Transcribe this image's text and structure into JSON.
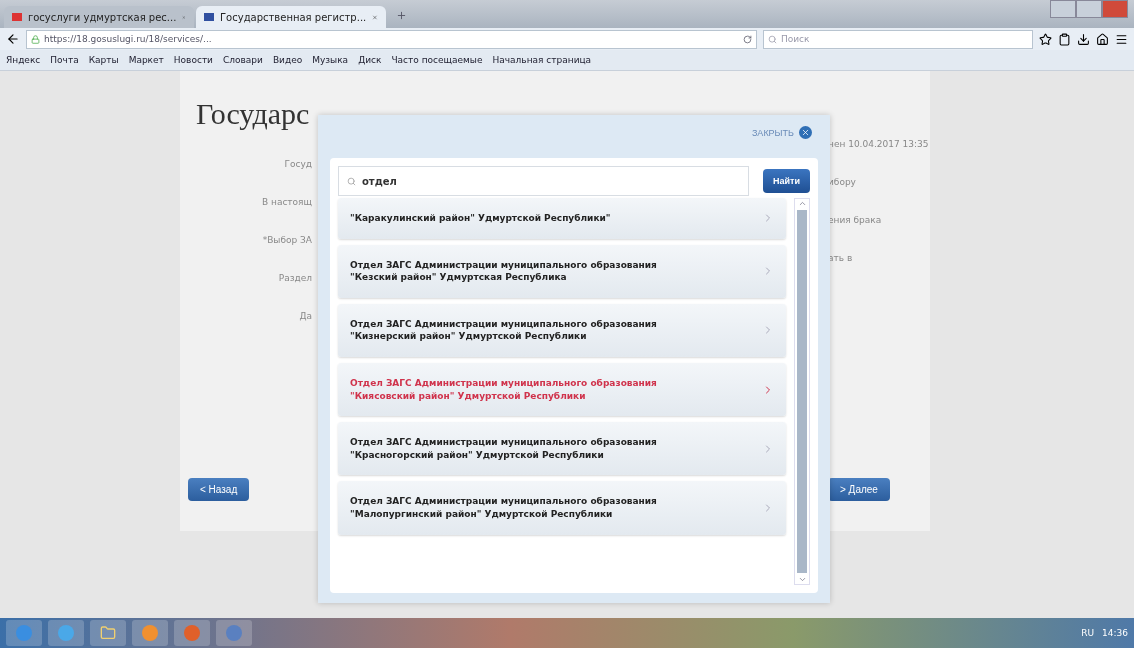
{
  "browser": {
    "tabs": [
      {
        "title": "госуслуги удмуртская рес...",
        "selected": false
      },
      {
        "title": "Государственная регистр...",
        "selected": true
      }
    ],
    "url": "https://18.gosuslugi.ru/18/services/...",
    "search_placeholder": "Поиск",
    "bookmarks": [
      "Яндекс",
      "Почта",
      "Карты",
      "Маркет",
      "Новости",
      "Словари",
      "Видео",
      "Музыка",
      "Диск",
      "Часто посещаемые",
      "Начальная страница"
    ]
  },
  "page": {
    "heading": "Государс",
    "left_labels": [
      "Госуд",
      "В настоящ",
      "*Выбор ЗА",
      "Раздел",
      "Да"
    ],
    "right_labels": [
      "нен 10.04.2017 13:35",
      "ибору",
      "ения брака",
      "ать в"
    ],
    "back_button": "< Назад",
    "next_button": "> Далее"
  },
  "modal": {
    "close_label": "ЗАКРЫТЬ",
    "search_value": "отдел",
    "search_button": "Найти",
    "results": [
      {
        "text": "\"Каракулинский район\" Удмуртской Республики\"",
        "selected": false
      },
      {
        "text": "Отдел ЗАГС Администрации муниципального образования \"Кезский район\" Удмуртская Республика",
        "selected": false
      },
      {
        "text": "Отдел ЗАГС Администрации муниципального образования \"Кизнерский район\" Удмуртской Республики",
        "selected": false
      },
      {
        "text": "Отдел ЗАГС Администрации муниципального образования \"Киясовский район\" Удмуртской Республики",
        "selected": true
      },
      {
        "text": "Отдел ЗАГС Администрации муниципального образования \"Красногорский район\" Удмуртской Республики",
        "selected": false
      },
      {
        "text": "Отдел ЗАГС Администрации муниципального образования \"Малопургинский район\" Удмуртской Республики",
        "selected": false
      }
    ]
  },
  "taskbar": {
    "language": "RU",
    "time": "14:36"
  }
}
